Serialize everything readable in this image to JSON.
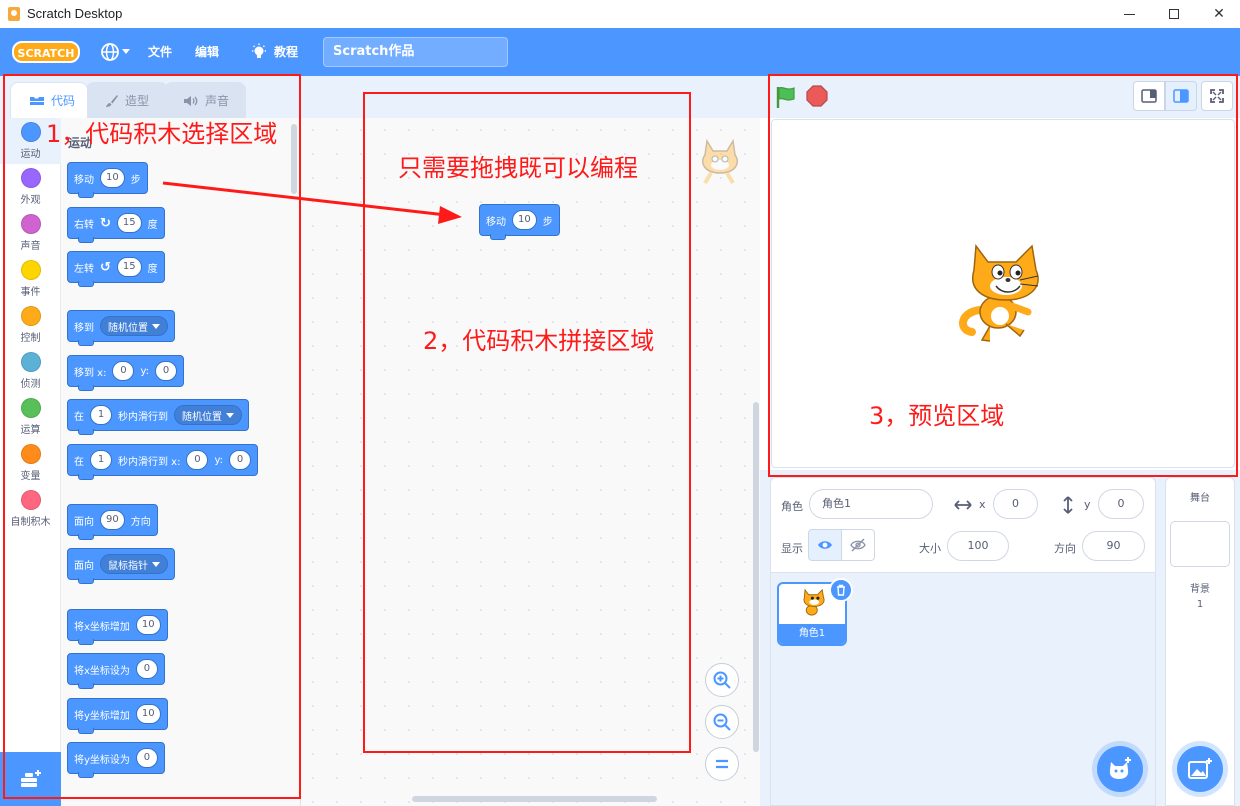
{
  "window": {
    "title": "Scratch Desktop"
  },
  "menubar": {
    "logo_text": "SCRATCH",
    "file": "文件",
    "edit": "编辑",
    "tutorials": "教程",
    "project_title": "Scratch作品"
  },
  "tabs": {
    "code": "代码",
    "costumes": "造型",
    "sounds": "声音"
  },
  "categories": [
    {
      "label": "运动",
      "color": "#4c97ff"
    },
    {
      "label": "外观",
      "color": "#9966ff"
    },
    {
      "label": "声音",
      "color": "#cf63cf"
    },
    {
      "label": "事件",
      "color": "#ffd500"
    },
    {
      "label": "控制",
      "color": "#ffab19"
    },
    {
      "label": "侦测",
      "color": "#5cb1d6"
    },
    {
      "label": "运算",
      "color": "#59c059"
    },
    {
      "label": "变量",
      "color": "#ff8c1a"
    },
    {
      "label": "自制积木",
      "color": "#ff6680"
    }
  ],
  "palette": {
    "heading": "运动",
    "move": {
      "a": "移动",
      "steps": "10",
      "b": "步"
    },
    "turn_right": {
      "a": "右转",
      "deg": "15",
      "b": "度"
    },
    "turn_left": {
      "a": "左转",
      "deg": "15",
      "b": "度"
    },
    "goto": {
      "a": "移到",
      "target": "随机位置"
    },
    "goto_xy": {
      "a": "移到 x:",
      "x": "0",
      "ylabel": "y:",
      "y": "0"
    },
    "glide_to": {
      "a": "在",
      "secs": "1",
      "b": "秒内滑行到",
      "target": "随机位置"
    },
    "glide_xy": {
      "a": "在",
      "secs": "1",
      "b": "秒内滑行到 x:",
      "x": "0",
      "ylabel": "y:",
      "y": "0"
    },
    "point_dir": {
      "a": "面向",
      "deg": "90",
      "b": "方向"
    },
    "point_towards": {
      "a": "面向",
      "target": "鼠标指针"
    },
    "change_x": {
      "a": "将x坐标增加",
      "val": "10"
    },
    "set_x": {
      "a": "将x坐标设为",
      "val": "0"
    },
    "change_y": {
      "a": "将y坐标增加",
      "val": "10"
    },
    "set_y": {
      "a": "将y坐标设为",
      "val": "0"
    }
  },
  "script": {
    "move": {
      "a": "移动",
      "steps": "10",
      "b": "步"
    }
  },
  "sprite_info": {
    "sprite_label": "角色",
    "sprite_name": "角色1",
    "x_label": "x",
    "x": "0",
    "y_label": "y",
    "y": "0",
    "show_label": "显示",
    "size_label": "大小",
    "size": "100",
    "direction_label": "方向",
    "direction": "90"
  },
  "sprite_list": [
    {
      "name": "角色1"
    }
  ],
  "stage_panel": {
    "title": "舞台",
    "backdrop_label": "背景",
    "backdrop_count": "1"
  },
  "annotations": {
    "area1": "1，代码积木选择区域",
    "drag_hint": "只需要拖拽既可以编程",
    "area2": "2，代码积木拼接区域",
    "area3": "3，预览区域"
  },
  "colors": {
    "menu_blue": "#4c97ff",
    "motion_block": "#4c97ff",
    "annotation_red": "#ff1a1a",
    "flag_green": "#4cbf56",
    "stop_red": "#ec5959"
  },
  "icons": {
    "globe": "globe-icon",
    "tutorials": "lightbulb-icon",
    "flag": "green-flag-icon",
    "stop": "stop-icon",
    "extension": "add-extension-icon"
  }
}
